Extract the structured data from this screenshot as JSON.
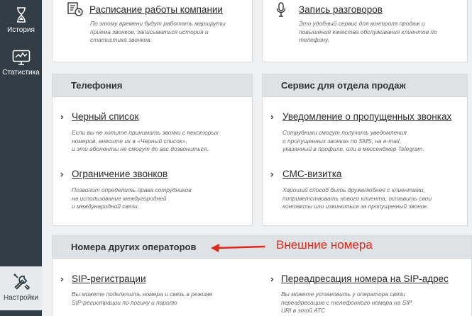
{
  "sidebar": {
    "items": [
      {
        "label": "История",
        "icon": "hourglass-icon"
      },
      {
        "label": "Статистика",
        "icon": "chart-monitor-icon"
      },
      {
        "label": "Настройки",
        "icon": "tools-icon"
      }
    ]
  },
  "top_cards": [
    {
      "title": "Расписание работы компании",
      "icon": "clock-list-icon",
      "desc": [
        "По этому времени будут работать маршруты",
        "приема звонков, записываться история и",
        "статистика звонков."
      ]
    },
    {
      "title": "Запись разговоров",
      "icon": "microphone-icon",
      "desc": [
        "Это удобный сервис для контроля продаж и",
        "повышения качества обслуживания клиентов по",
        "телефону."
      ]
    }
  ],
  "telephony": {
    "header": "Телефония",
    "items": [
      {
        "title": "Черный список",
        "desc": [
          "Если вы не хотите принимать звонки с некоторых",
          "номеров, внесите их в «Черный список»,",
          "и эти абоненты не смогут до вас дозвониться."
        ]
      },
      {
        "title": "Ограничение звонков",
        "desc": [
          "Позволит определить права сотрудников",
          "на использование междугородней",
          "и международной связи."
        ]
      }
    ]
  },
  "sales": {
    "header": "Сервис для отдела продаж",
    "items": [
      {
        "title": "Уведомление о пропущенных звонках",
        "desc": [
          "Сотрудники смогут получать уведомления",
          "о пропущенных звонках по SMS, на e-mail,",
          "указанный в профиле, или в мессенджер Telegram."
        ]
      },
      {
        "title": "СМС-визитка",
        "desc": [
          "Хороший способ быть дружелюбнее с клиентами,",
          "поприветствовать нового клиента, оставить свои",
          "контакты или извиниться за пропущенный звонок."
        ]
      }
    ]
  },
  "other_numbers": {
    "header": "Номера других операторов",
    "annotation": "Внешние номера",
    "items": [
      {
        "title": "SIP-регистрации",
        "desc": [
          "Вы можете подключить номера и связь в режиме",
          "SIP-регистрации по логину и паролю"
        ]
      },
      {
        "title": "Переадресация номера на SIP-адрес",
        "desc": [
          "Вы можете установить у оператора связи",
          "переадресацию с телефонного номера на SIP",
          "URI в этой АТС"
        ]
      }
    ]
  },
  "colors": {
    "sidebar": "#323d45",
    "card_header": "#dfe2e4",
    "annotation": "#e1271c"
  }
}
